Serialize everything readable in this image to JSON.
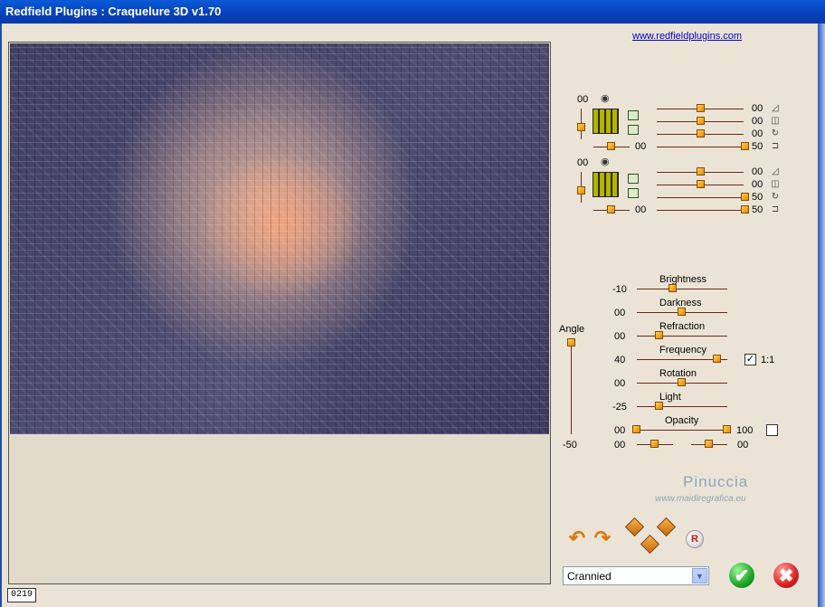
{
  "window": {
    "title": "Redfield Plugins : Craquelure 3D  v1.70"
  },
  "link": "www.redfieldplugins.com",
  "preview": {
    "counter": "0219"
  },
  "layers": [
    {
      "left_value": "00",
      "rows": [
        {
          "value": "00"
        },
        {
          "value": "00"
        },
        {
          "value": "00"
        },
        {
          "left": "00",
          "value": "50"
        }
      ]
    },
    {
      "left_value": "00",
      "rows": [
        {
          "value": "00"
        },
        {
          "value": "00"
        },
        {
          "value": "50"
        },
        {
          "left": "00",
          "value": "50"
        }
      ]
    }
  ],
  "angle": {
    "label": "Angle",
    "min_label": "-50"
  },
  "sliders": [
    {
      "label": "Brightness",
      "value": "-10"
    },
    {
      "label": "Darkness",
      "value": "00"
    },
    {
      "label": "Refraction",
      "value": "00"
    },
    {
      "label": "Frequency",
      "value": "40",
      "check_label": "1:1",
      "checked": true
    },
    {
      "label": "Rotation",
      "value": "00"
    },
    {
      "label": "Light",
      "value": "-25"
    },
    {
      "label": "Opacity",
      "value": "00",
      "right_value": "100"
    }
  ],
  "bottom_pair": {
    "left": "00",
    "right": "00"
  },
  "watermark": {
    "name": "Pinuccia",
    "site": "www.maidiregrafica.eu"
  },
  "preset": {
    "selected": "Crannied"
  },
  "reset_label": "R",
  "ok_symbol": "✔",
  "cancel_symbol": "✖"
}
